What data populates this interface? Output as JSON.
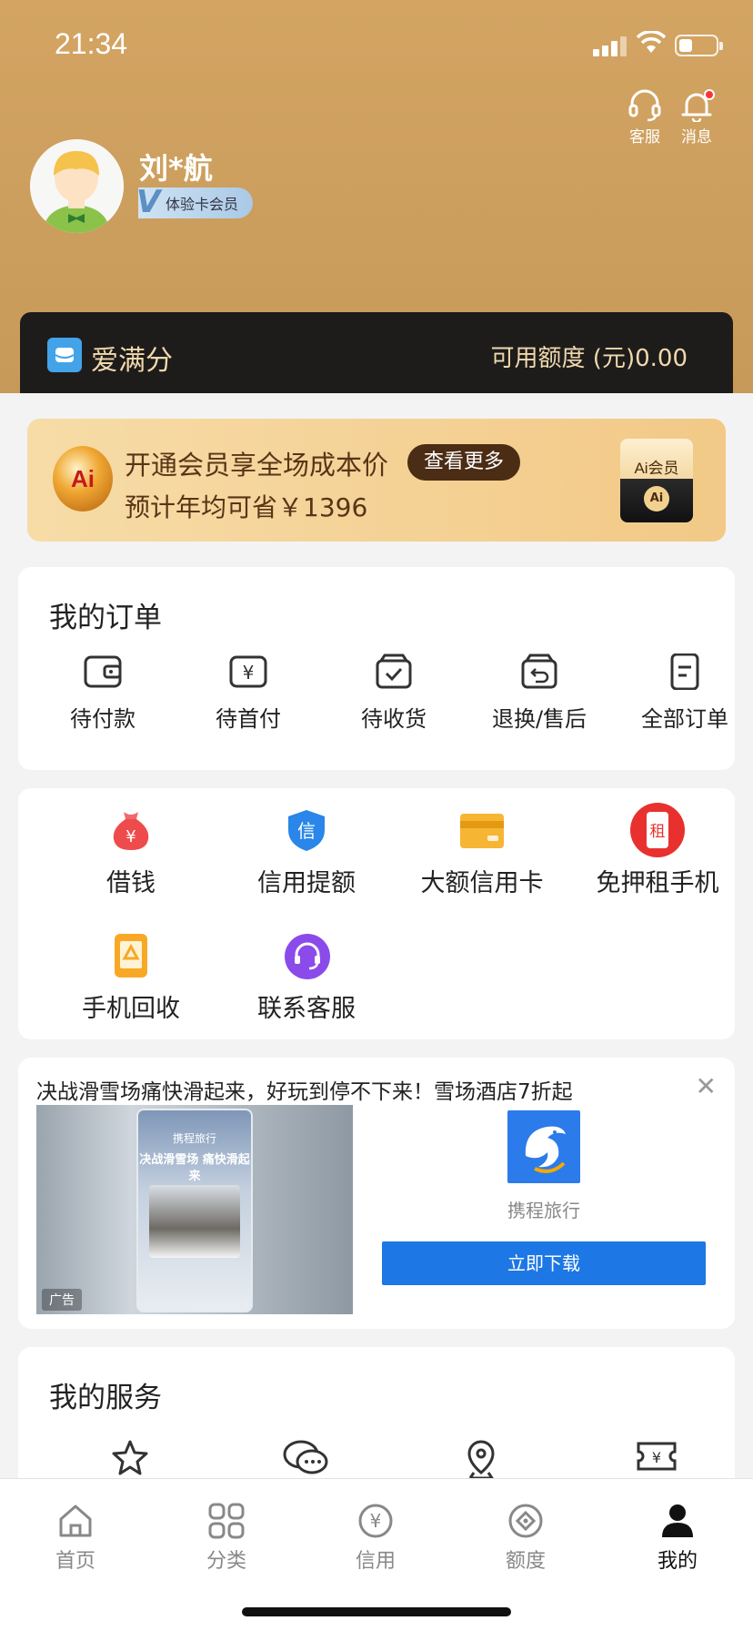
{
  "status_bar": {
    "time": "21:34"
  },
  "top_actions": [
    {
      "label": "客服",
      "icon": "headset-icon"
    },
    {
      "label": "消息",
      "icon": "bell-icon"
    }
  ],
  "user": {
    "name": "刘*航",
    "badge": "体验卡会员",
    "badge_mark": "V"
  },
  "credit_bar": {
    "title": "爱满分",
    "quota": "可用额度 (元)0.00"
  },
  "promo": {
    "line1": "开通会员享全场成本价",
    "button": "查看更多",
    "line2": "预计年均可省￥1396",
    "ai_mark": "Ai",
    "card_title": "Ai会员",
    "card_coin": "Ai"
  },
  "orders": {
    "title": "我的订单",
    "items": [
      {
        "label": "待付款",
        "icon": "wallet-icon"
      },
      {
        "label": "待首付",
        "icon": "yen-box-icon"
      },
      {
        "label": "待收货",
        "icon": "box-check-icon"
      },
      {
        "label": "退换/售后",
        "icon": "return-icon"
      },
      {
        "label": "全部订单",
        "icon": "document-icon"
      }
    ]
  },
  "services": {
    "items": [
      {
        "label": "借钱",
        "icon": "money-bag-icon"
      },
      {
        "label": "信用提额",
        "icon": "credit-shield-icon",
        "glyph": "信"
      },
      {
        "label": "大额信用卡",
        "icon": "credit-card-icon"
      },
      {
        "label": "免押租手机",
        "icon": "rent-phone-icon",
        "glyph": "租"
      },
      {
        "label": "手机回收",
        "icon": "phone-recycle-icon"
      },
      {
        "label": "联系客服",
        "icon": "customer-service-icon"
      }
    ]
  },
  "ad": {
    "title": "决战滑雪场痛快滑起来，好玩到停不下来！雪场酒店7折起",
    "brand": "携程旅行",
    "cta": "立即下载",
    "badge": "广告",
    "phone_header": "携程旅行",
    "phone_text": "决战滑雪场 痛快滑起来"
  },
  "my_services": {
    "title": "我的服务",
    "icons": [
      "star-icon",
      "chat-icon",
      "location-icon",
      "ticket-icon"
    ]
  },
  "tabbar": [
    {
      "label": "首页",
      "icon": "home-icon"
    },
    {
      "label": "分类",
      "icon": "grid-icon"
    },
    {
      "label": "信用",
      "icon": "yen-circle-icon"
    },
    {
      "label": "额度",
      "icon": "diamond-circle-icon"
    },
    {
      "label": "我的",
      "icon": "person-icon",
      "active": true
    }
  ],
  "colors": {
    "header": "#d3a462",
    "accent_blue": "#1d77e4",
    "gold_text": "#f1d8ad"
  }
}
